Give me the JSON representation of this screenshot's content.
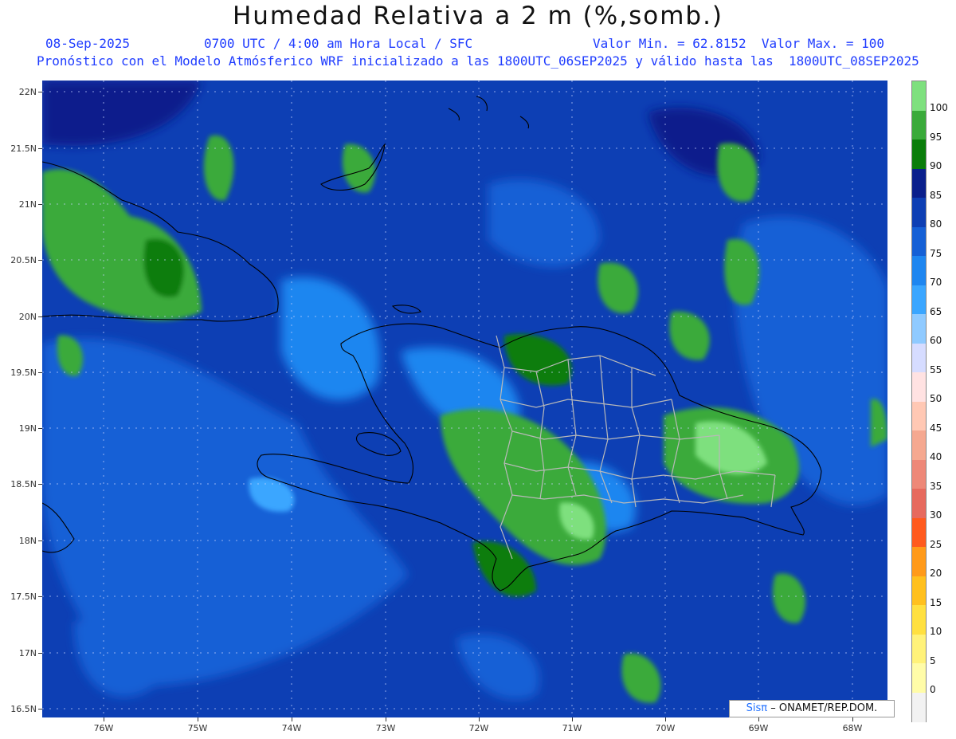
{
  "header": {
    "title": "Humedad Relativa a 2 m (%,somb.)",
    "date": "08-Sep-2025",
    "time_info": "0700 UTC / 4:00 am Hora Local / SFC",
    "min_max": "Valor Min. = 62.8152  Valor Max. = 100",
    "model_info": "Pronóstico con el Modelo Atmósferico WRF inicializado a las 1800UTC_06SEP2025 y válido hasta las  1800UTC_08SEP2025"
  },
  "axes": {
    "lat_labels": [
      "22N",
      "21.5N",
      "21N",
      "20.5N",
      "20N",
      "19.5N",
      "19N",
      "18.5N",
      "18N",
      "17.5N",
      "17N",
      "16.5N"
    ],
    "lon_labels": [
      "76W",
      "75W",
      "74W",
      "73W",
      "72W",
      "71W",
      "70W",
      "69W",
      "68W"
    ]
  },
  "colorbar": {
    "labels": [
      "100",
      "95",
      "90",
      "85",
      "80",
      "75",
      "70",
      "65",
      "60",
      "55",
      "50",
      "45",
      "40",
      "35",
      "30",
      "25",
      "20",
      "15",
      "10",
      "5",
      "0"
    ],
    "colors": [
      "#7ee07e",
      "#3aaa3a",
      "#0a7d0a",
      "#0a1f8c",
      "#0d3fb4",
      "#1560d6",
      "#1e86f0",
      "#3aa6ff",
      "#8fcaff",
      "#d6dcff",
      "#ffe2e2",
      "#ffc8b4",
      "#f5a890",
      "#ee8878",
      "#e76a5e",
      "#ff5a1e",
      "#ff9a1a",
      "#ffc01e",
      "#ffe040",
      "#fff27a",
      "#fffca8",
      "#f2f2f2"
    ]
  },
  "credit": {
    "logo": "Sisπ",
    "text": "– ONAMET/REP.DOM."
  }
}
